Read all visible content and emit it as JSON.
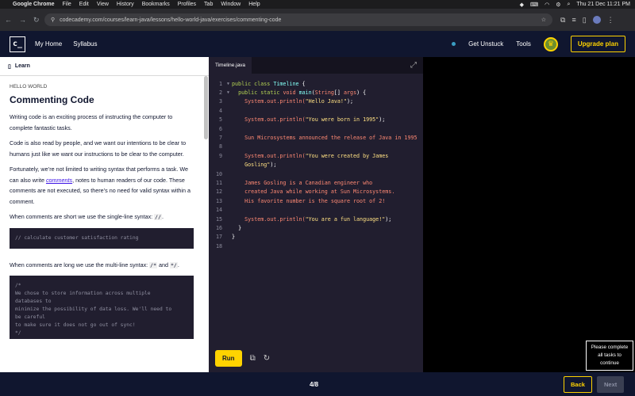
{
  "mac": {
    "apple": "",
    "app": "Google Chrome",
    "menus": [
      "File",
      "Edit",
      "View",
      "History",
      "Bookmarks",
      "Profiles",
      "Tab",
      "Window",
      "Help"
    ],
    "datetime": "Thu 21 Dec  11:21 PM"
  },
  "browser": {
    "url": "codecademy.com/courses/learn-java/lessons/hello-world-java/exercises/commenting-code"
  },
  "header": {
    "logo": "c_",
    "my_home": "My Home",
    "syllabus": "Syllabus",
    "get_unstuck": "Get Unstuck",
    "tools": "Tools",
    "upgrade": "Upgrade plan"
  },
  "learn": {
    "tab": "Learn",
    "kicker": "HELLO WORLD",
    "title": "Commenting Code",
    "p1": "Writing code is an exciting process of instructing the computer to complete fantastic tasks.",
    "p2": "Code is also read by people, and we want our intentions to be clear to humans just like we want our instructions to be clear to the computer.",
    "p3a": "Fortunately, we’re not limited to writing syntax that performs a task. We can also write ",
    "p3link": "comments",
    "p3b": ", notes to human readers of our code. These comments are not executed, so there’s no need for valid syntax within a comment.",
    "p4a": "When comments are short we use the single-line syntax: ",
    "p4code": "//",
    "p4b": ".",
    "code1": "// calculate customer satisfaction rating",
    "p5a": "When comments are long we use the multi-line syntax: ",
    "p5code1": "/*",
    "p5mid": " and ",
    "p5code2": "*/",
    "p5b": ".",
    "code2": "/*\nWe chose to store information across multiple\ndatabases to\nminimize the possibility of data loss. We'll need to\nbe careful\nto make sure it does not go out of sync!\n*/"
  },
  "editor": {
    "filename": "Timeline.java",
    "run": "Run",
    "line_numbers": [
      "1",
      "2",
      "3",
      "4",
      "5",
      "6",
      "7",
      "8",
      "9",
      "",
      "10",
      "11",
      "12",
      "13",
      "14",
      "15",
      "16",
      "17",
      "18"
    ],
    "l1_kw": "public class ",
    "l1_cls": "Timeline",
    "l1_end": " {",
    "l2_kw": "public static ",
    "l2_void": "void ",
    "l2_main": "main",
    "l2_p1": "(",
    "l2_type": "String",
    "l2_p2": "[] ",
    "l2_args": "args",
    "l2_end": ") {",
    "l3_a": "System.out.println(",
    "l3_s": "\"Hello Java!\"",
    "l3_b": ");",
    "l5_a": "System.out.println(",
    "l5_s": "\"You were born in 1995\"",
    "l5_b": ");",
    "l7": "Sun Microsystems announced the release of Java in 1995",
    "l9_a": "System.out.println(",
    "l9_s": "\"You were created by James",
    "l9_cont_s": "Gosling\"",
    "l9_cont_b": ");",
    "l11": "James Gosling is a Canadian engineer who",
    "l12": "created Java while working at Sun Microsystems.",
    "l13": "His favorite number is the square root of 2!",
    "l15_a": "System.out.println(",
    "l15_s": "\"You are a fun language!\"",
    "l15_b": ");",
    "l16": "}",
    "l17": "}"
  },
  "footer": {
    "progress": "4/8",
    "back": "Back",
    "next": "Next",
    "tooltip": "Please complete all tasks to continue"
  }
}
